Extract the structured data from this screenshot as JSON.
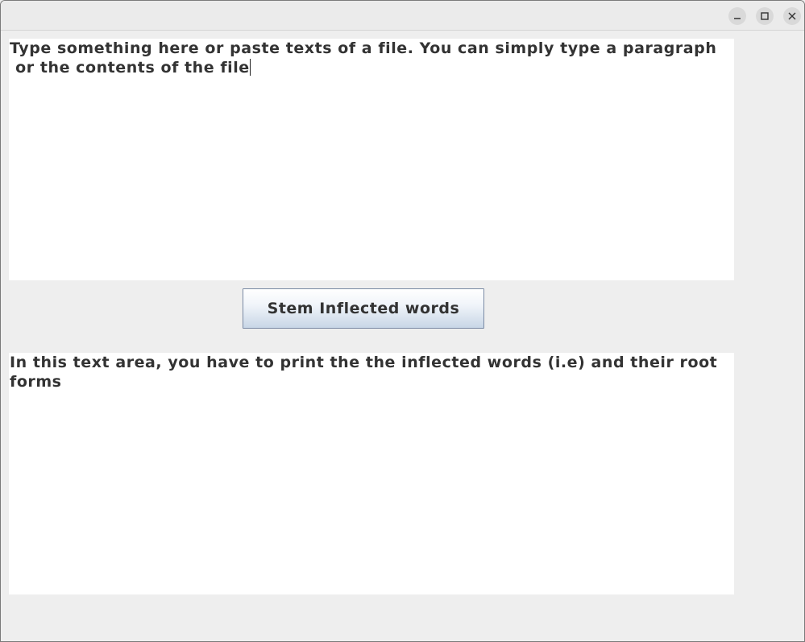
{
  "window": {
    "title": "",
    "controls": {
      "minimize_icon": "minimize-icon",
      "maximize_icon": "maximize-icon",
      "close_icon": "close-icon"
    }
  },
  "input_area": {
    "text_line1": "Type something here or paste texts of a file. You can simply type a paragraph",
    "text_line2": " or the contents of the file"
  },
  "stem_button": {
    "label": "Stem Inflected words"
  },
  "output_area": {
    "text_line1": "In this text area, you have to print the the inflected words (i.e) and their root",
    "text_line2": "forms"
  },
  "colors": {
    "background": "#eeeeee",
    "text": "#333333",
    "textarea_bg": "#ffffff",
    "button_border": "#7a8aa4"
  }
}
